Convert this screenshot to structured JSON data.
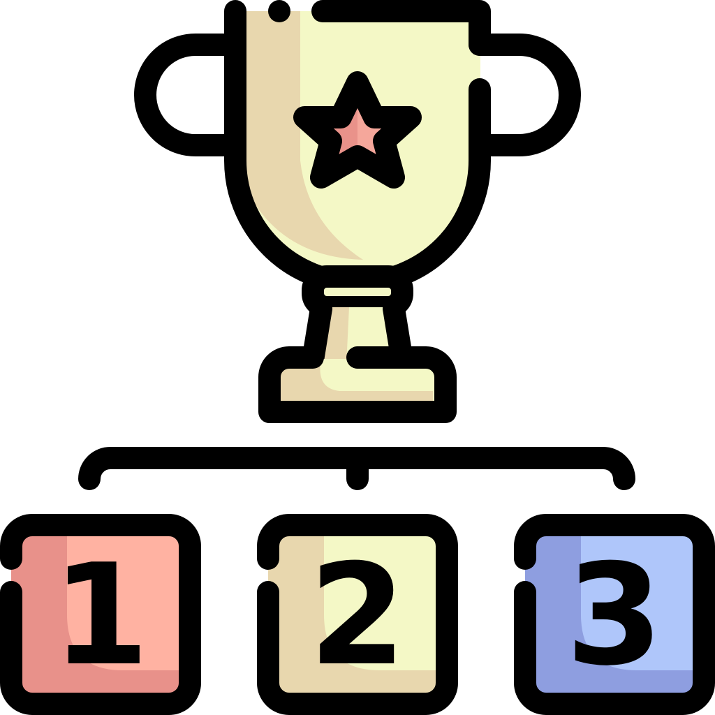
{
  "icon": {
    "name": "trophy-ranking-icon",
    "colors": {
      "outline": "#000000",
      "cup": "#F4F8C6",
      "cup_shadow": "#E8D7AE",
      "star": "#F5A79B",
      "star_shadow": "#E9928A",
      "rank_1_fill": "#FFB2A2",
      "rank_1_shadow": "#E8918A",
      "rank_2_fill": "#F4F8C6",
      "rank_2_shadow": "#E8D7AE",
      "rank_3_fill": "#AFC6FA",
      "rank_3_shadow": "#8E9EE0"
    }
  },
  "ranks": [
    {
      "label": "1"
    },
    {
      "label": "2"
    },
    {
      "label": "3"
    }
  ]
}
